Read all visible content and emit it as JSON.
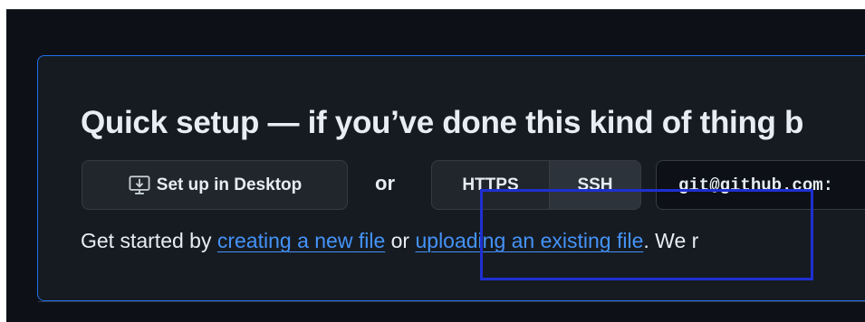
{
  "quick_setup": {
    "title": "Quick setup — if you’ve done this kind of thing b",
    "desktop_button_label": "Set up in Desktop",
    "or_label": "or",
    "protocols": [
      {
        "label": "HTTPS",
        "selected": false
      },
      {
        "label": "SSH",
        "selected": true
      }
    ],
    "clone_url": "git@github.com:",
    "intro": {
      "prefix": "Get started by ",
      "link_new_file": "creating a new file",
      "middle": " or ",
      "link_upload": "uploading an existing file",
      "suffix": ". We r"
    }
  },
  "icons": {
    "desktop": "desktop-download-icon"
  },
  "colors": {
    "background": "#0d1117",
    "panel": "#161b22",
    "panel_border": "#1f6feb",
    "link": "#4493f8",
    "text": "#e6edf3",
    "highlight_box": "#1e2fd1"
  }
}
